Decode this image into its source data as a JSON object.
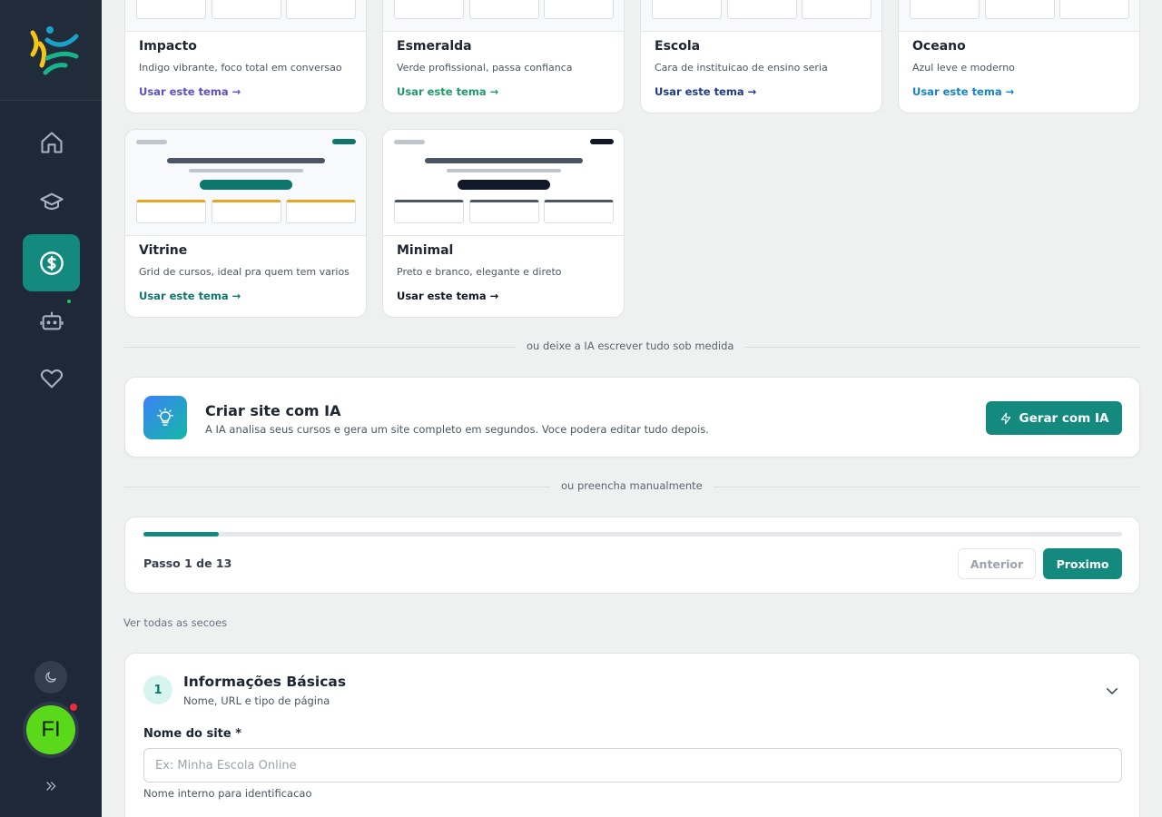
{
  "sidebar": {
    "nav": [
      {
        "icon": "home-icon",
        "active": false
      },
      {
        "icon": "graduation-cap-icon",
        "active": false
      },
      {
        "icon": "dollar-icon",
        "active": true
      },
      {
        "icon": "bot-icon",
        "active": false
      },
      {
        "icon": "heart-icon",
        "active": false
      }
    ],
    "avatar_initials": "FI"
  },
  "themes": [
    {
      "name": "Impacto",
      "desc": "Indigo vibrante, foco total em conversao",
      "link": "Usar este tema →",
      "color": "#5b50c9"
    },
    {
      "name": "Esmeralda",
      "desc": "Verde profissional, passa confianca",
      "link": "Usar este tema →",
      "color": "#1f9a68"
    },
    {
      "name": "Escola",
      "desc": "Cara de instituicao de ensino seria",
      "link": "Usar este tema →",
      "color": "#1e3a8a"
    },
    {
      "name": "Oceano",
      "desc": "Azul leve e moderno",
      "link": "Usar este tema →",
      "color": "#1684c4"
    },
    {
      "name": "Vitrine",
      "desc": "Grid de cursos, ideal pra quem tem varios",
      "link": "Usar este tema →",
      "color": "#0f766e"
    },
    {
      "name": "Minimal",
      "desc": "Preto e branco, elegante e direto",
      "link": "Usar este tema →",
      "color": "#111827"
    }
  ],
  "dividers": {
    "ai": "ou deixe a IA escrever tudo sob medida",
    "manual": "ou preencha manualmente"
  },
  "ai_card": {
    "title": "Criar site com IA",
    "subtitle": "A IA analisa seus cursos e gera um site completo em segundos. Voce podera editar tudo depois.",
    "button": "Gerar com IA"
  },
  "progress": {
    "step_label": "Passo 1 de 13",
    "fraction": 0.077,
    "prev": "Anterior",
    "next": "Proximo"
  },
  "see_all": "Ver todas as secoes",
  "section": {
    "number": "1",
    "title": "Informações Básicas",
    "subtitle": "Nome, URL e tipo de página",
    "field_label": "Nome do site *",
    "field_placeholder": "Ex: Minha Escola Online",
    "field_value": "",
    "field_hint": "Nome interno para identificacao"
  }
}
